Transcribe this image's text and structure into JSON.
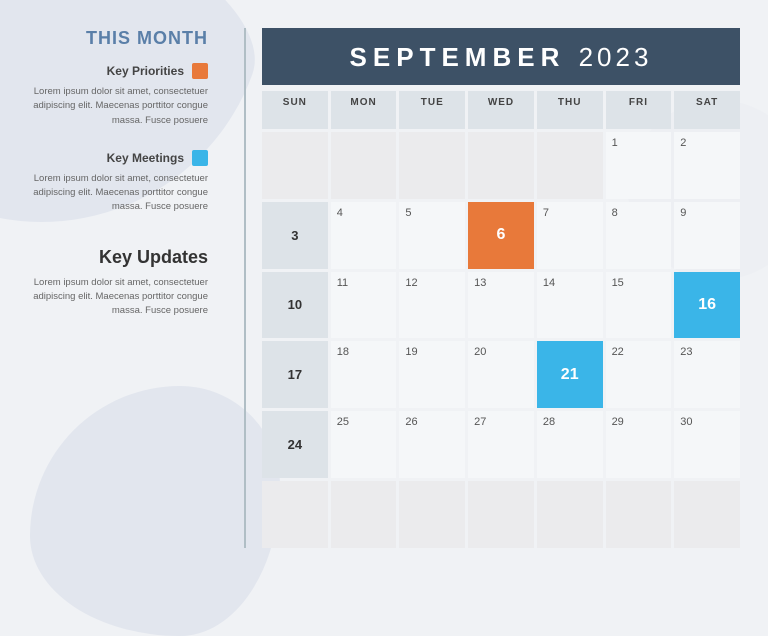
{
  "sidebar": {
    "this_month_label": "THIS MONTH",
    "key_priorities_label": "Key Priorities",
    "key_priorities_text": "Lorem ipsum dolor sit amet, consectetuer adipiscing elit. Maecenas porttitor congue massa. Fusce posuere",
    "key_meetings_label": "Key Meetings",
    "key_meetings_text": "Lorem ipsum dolor sit amet, consectetuer adipiscing elit. Maecenas porttitor congue massa. Fusce posuere",
    "key_updates_label": "Key Updates",
    "key_updates_text": "Lorem ipsum dolor sit amet, consectetuer adipiscing elit. Maecenas porttitor congue massa. Fusce posuere"
  },
  "calendar": {
    "month": "SEPTEMBER",
    "year": "2023",
    "days_of_week": [
      "SUN",
      "MON",
      "TUE",
      "WED",
      "THU",
      "FRI",
      "SAT"
    ],
    "week1": {
      "label": "",
      "days": [
        "",
        "",
        "",
        "",
        "1",
        "2"
      ]
    },
    "week2": {
      "label": "3",
      "days": [
        "4",
        "5",
        "6",
        "7",
        "8",
        "9"
      ]
    },
    "week3": {
      "label": "10",
      "days": [
        "11",
        "12",
        "13",
        "14",
        "15",
        "16"
      ]
    },
    "week4": {
      "label": "17",
      "days": [
        "18",
        "19",
        "20",
        "21",
        "22",
        "23"
      ]
    },
    "week5": {
      "label": "24",
      "days": [
        "25",
        "26",
        "27",
        "28",
        "29",
        "30"
      ]
    },
    "week6": {
      "label": "",
      "days": [
        "",
        "",
        "",
        "",
        "",
        ""
      ]
    },
    "highlight_orange": "6",
    "highlight_blue_1": "16",
    "highlight_blue_2": "21"
  },
  "colors": {
    "orange": "#e8793a",
    "blue": "#3ab5e8",
    "header_bg": "#3d5166"
  }
}
